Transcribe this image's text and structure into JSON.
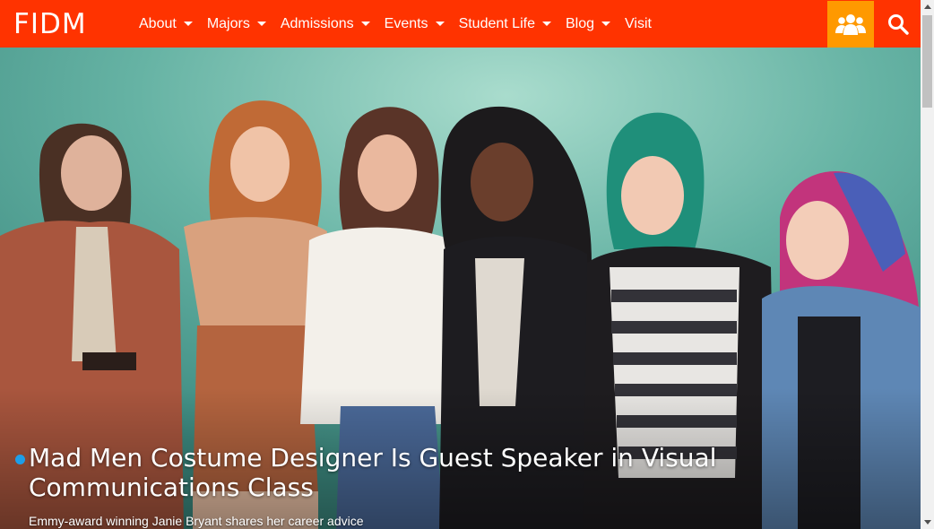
{
  "brand": {
    "logo_text": "FIDM"
  },
  "nav": {
    "items": [
      {
        "label": "About",
        "dropdown": true
      },
      {
        "label": "Majors",
        "dropdown": true
      },
      {
        "label": "Admissions",
        "dropdown": true
      },
      {
        "label": "Events",
        "dropdown": true
      },
      {
        "label": "Student Life",
        "dropdown": true
      },
      {
        "label": "Blog",
        "dropdown": true
      },
      {
        "label": "Visit",
        "dropdown": false
      }
    ],
    "people_icon": "people-group-icon",
    "search_icon": "search-icon"
  },
  "hero": {
    "headline": "Mad Men Costume Designer Is Guest Speaker in Visual Communications Class",
    "subheadline": "Emmy-award winning Janie Bryant shares her career advice"
  },
  "colors": {
    "nav_background": "#ff3300",
    "people_button": "#ff9900",
    "backdrop_teal": "#58a799",
    "bullet": "#1e9ee8"
  }
}
